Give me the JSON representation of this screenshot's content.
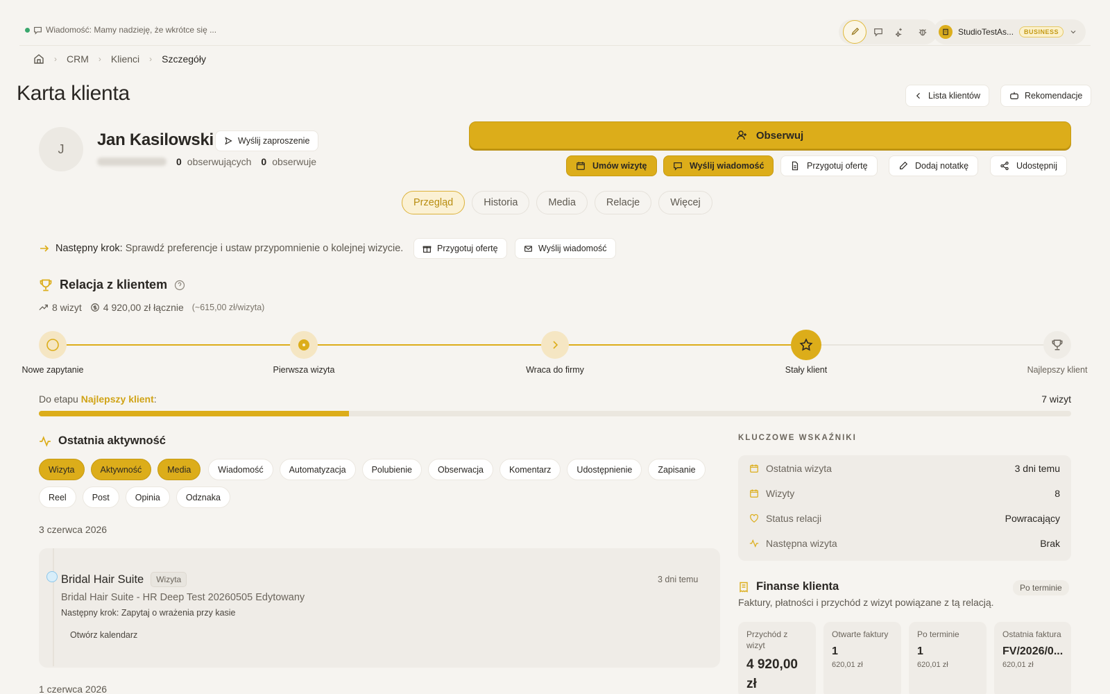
{
  "topbar": {
    "status_message": "Wiadomość: Mamy nadzieję, że wkrótce się ...",
    "account_name": "StudioTestAs...",
    "account_badge": "BUSINESS"
  },
  "breadcrumb": [
    "CRM",
    "Klienci",
    "Szczegóły"
  ],
  "page": {
    "title": "Karta klienta",
    "client_list_btn": "Lista klientów",
    "recommendations_btn": "Rekomendacje"
  },
  "profile": {
    "initial": "J",
    "name": "Jan Kasilowski",
    "invite_btn": "Wyślij zaproszenie",
    "followers_count": "0",
    "followers_label": "obserwujących",
    "following_count": "0",
    "following_label": "obserwuje",
    "follow_btn": "Obserwuj"
  },
  "actions": {
    "book_visit": "Umów wizytę",
    "send_message": "Wyślij wiadomość",
    "prepare_offer": "Przygotuj ofertę",
    "add_note": "Dodaj notatkę",
    "share": "Udostępnij"
  },
  "tabs": [
    "Przegląd",
    "Historia",
    "Media",
    "Relacje",
    "Więcej"
  ],
  "next_step": {
    "label": "Następny krok:",
    "text": "Sprawdź preferencje i ustaw przypomnienie o kolejnej wizycie.",
    "offer_btn": "Przygotuj ofertę",
    "message_btn": "Wyślij wiadomość"
  },
  "relation": {
    "title": "Relacja z klientem",
    "visits": "8 wizyt",
    "total": "4 920,00 zł łącznie",
    "avg": "(~615,00 zł/wizyta)",
    "stages": [
      "Nowe zapytanie",
      "Pierwsza wizyta",
      "Wraca do firmy",
      "Stały klient",
      "Najlepszy klient"
    ],
    "current_stage_index": 3,
    "to_stage_prefix": "Do etapu",
    "to_stage_name": "Najlepszy klient",
    "to_stage_suffix": ":",
    "remaining": "7 wizyt",
    "progress_fraction": 0.3
  },
  "activity": {
    "title": "Ostatnia aktywność",
    "filters": [
      {
        "label": "Wizyta",
        "on": true
      },
      {
        "label": "Aktywność",
        "on": true
      },
      {
        "label": "Media",
        "on": true
      },
      {
        "label": "Wiadomość",
        "on": false
      },
      {
        "label": "Automatyzacja",
        "on": false
      },
      {
        "label": "Polubienie",
        "on": false
      },
      {
        "label": "Obserwacja",
        "on": false
      },
      {
        "label": "Komentarz",
        "on": false
      },
      {
        "label": "Udostępnienie",
        "on": false
      },
      {
        "label": "Zapisanie",
        "on": false
      },
      {
        "label": "Reel",
        "on": false
      },
      {
        "label": "Post",
        "on": false
      },
      {
        "label": "Opinia",
        "on": false
      },
      {
        "label": "Odznaka",
        "on": false
      }
    ],
    "date1": "3 czerwca 2026",
    "event": {
      "title": "Bridal Hair Suite",
      "badge": "Wizyta",
      "time": "3 dni temu",
      "subtitle": "Bridal Hair Suite - HR Deep Test 20260505 Edytowany",
      "next_step": "Następny krok: Zapytaj o wrażenia przy kasie",
      "link": "Otwórz kalendarz"
    },
    "date2": "1 czerwca 2026"
  },
  "kpi": {
    "heading": "KLUCZOWE WSKAŹNIKI",
    "rows": [
      {
        "label": "Ostatnia wizyta",
        "value": "3 dni temu"
      },
      {
        "label": "Wizyty",
        "value": "8"
      },
      {
        "label": "Status relacji",
        "value": "Powracający"
      },
      {
        "label": "Następna wizyta",
        "value": "Brak"
      }
    ]
  },
  "finance": {
    "title": "Finanse klienta",
    "badge": "Po terminie",
    "subtitle": "Faktury, płatności i przychód z wizyt powiązane z tą relacją.",
    "cards": [
      {
        "label": "Przychód z wizyt",
        "value": "4 920,00 zł",
        "amount": ""
      },
      {
        "label": "Otwarte faktury",
        "value": "1",
        "amount": "620,01 zł"
      },
      {
        "label": "Po terminie",
        "value": "1",
        "amount": "620,01 zł"
      },
      {
        "label": "Ostatnia faktura",
        "value": "FV/2026/0...",
        "amount": "620,01 zł"
      }
    ]
  }
}
